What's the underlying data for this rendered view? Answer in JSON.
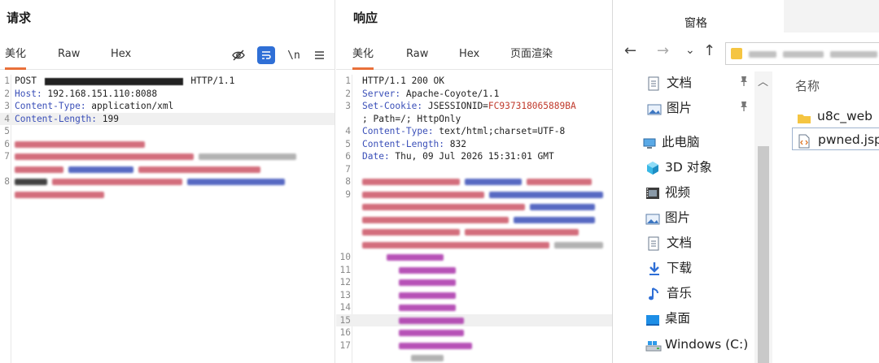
{
  "request": {
    "title": "请求",
    "tabs": [
      "美化",
      "Raw",
      "Hex"
    ],
    "tools": [
      "\\n"
    ],
    "lines": [
      {
        "n": "1",
        "parts": [
          {
            "t": "POST "
          },
          {
            "redact": true
          },
          {
            "t": " HTTP/1.1"
          }
        ]
      },
      {
        "n": "2",
        "parts": [
          {
            "t": "Host: ",
            "c": "k"
          },
          {
            "t": "192.168.151.110:8088"
          }
        ]
      },
      {
        "n": "3",
        "parts": [
          {
            "t": "Content-Type: ",
            "c": "k"
          },
          {
            "t": "application/xml"
          }
        ]
      },
      {
        "n": "4",
        "hl": true,
        "parts": [
          {
            "t": "Content-Length: ",
            "c": "k"
          },
          {
            "t": "199"
          }
        ]
      },
      {
        "n": "5",
        "parts": []
      },
      {
        "n": "6",
        "blur": [
          [
            "#c56",
            160
          ]
        ]
      },
      {
        "n": "7",
        "blur": [
          [
            "#c56",
            220
          ],
          [
            "#a5a5a5",
            120
          ]
        ]
      },
      {
        "n": "",
        "blur": [
          [
            "#c56",
            60
          ],
          [
            "#3a4fb8",
            80
          ],
          [
            "#c56",
            150
          ]
        ]
      },
      {
        "n": "8",
        "blur": [
          [
            "#222",
            40
          ],
          [
            "#c56",
            160
          ],
          [
            "#3a4fb8",
            120
          ]
        ]
      },
      {
        "n": "",
        "blur": [
          [
            "#c56",
            110
          ]
        ]
      }
    ]
  },
  "response": {
    "title": "响应",
    "tabs": [
      "美化",
      "Raw",
      "Hex",
      "页面渲染"
    ],
    "lines": [
      {
        "n": "1",
        "parts": [
          {
            "t": "HTTP/1.1 200 OK"
          }
        ]
      },
      {
        "n": "2",
        "parts": [
          {
            "t": "Server: ",
            "c": "k"
          },
          {
            "t": "Apache-Coyote/1.1"
          }
        ]
      },
      {
        "n": "3",
        "parts": [
          {
            "t": "Set-Cookie: ",
            "c": "k"
          },
          {
            "t": "JSESSIONID="
          },
          {
            "t": "FC937318065889BA",
            "c": "red"
          }
        ]
      },
      {
        "n": "",
        "parts": [
          {
            "t": "; Path=/; HttpOnly"
          }
        ]
      },
      {
        "n": "4",
        "parts": [
          {
            "t": "Content-Type: ",
            "c": "k"
          },
          {
            "t": "text/html;charset=UTF-8"
          }
        ]
      },
      {
        "n": "5",
        "parts": [
          {
            "t": "Content-Length: ",
            "c": "k"
          },
          {
            "t": "832"
          }
        ]
      },
      {
        "n": "6",
        "parts": [
          {
            "t": "Date: ",
            "c": "k"
          },
          {
            "t": "Thu, 09 Jul 2026 15:31:01 GMT"
          }
        ]
      },
      {
        "n": "7",
        "parts": []
      },
      {
        "n": "8",
        "blur": [
          [
            "#c56",
            120
          ],
          [
            "#3a4fb8",
            70
          ],
          [
            "#c56",
            80
          ]
        ]
      },
      {
        "n": "9",
        "blur": [
          [
            "#c56",
            150
          ],
          [
            "#3a4fb8",
            140
          ]
        ]
      },
      {
        "n": "",
        "blur": [
          [
            "#c56",
            200
          ],
          [
            "#3a4fb8",
            80
          ]
        ]
      },
      {
        "n": "",
        "blur": [
          [
            "#c56",
            180
          ],
          [
            "#3a4fb8",
            100
          ]
        ]
      },
      {
        "n": "",
        "blur": [
          [
            "#c56",
            120
          ],
          [
            "#c56",
            140
          ]
        ]
      },
      {
        "n": "",
        "blur": [
          [
            "#c56",
            230
          ],
          [
            "#a5a5a5",
            60
          ]
        ]
      },
      {
        "n": "10",
        "blur": [
          [
            "#a3a",
            70
          ]
        ],
        "indent": 30
      },
      {
        "n": "11",
        "blur": [
          [
            "#a3a",
            70
          ]
        ],
        "indent": 45
      },
      {
        "n": "12",
        "blur": [
          [
            "#a3a",
            70
          ]
        ],
        "indent": 45
      },
      {
        "n": "13",
        "blur": [
          [
            "#a3a",
            70
          ]
        ],
        "indent": 45
      },
      {
        "n": "14",
        "blur": [
          [
            "#a3a",
            70
          ]
        ],
        "indent": 45
      },
      {
        "n": "15",
        "hl": true,
        "blur": [
          [
            "#a3a",
            80
          ]
        ],
        "indent": 45
      },
      {
        "n": "16",
        "blur": [
          [
            "#a3a",
            80
          ]
        ],
        "indent": 45
      },
      {
        "n": "17",
        "blur": [
          [
            "#a3a",
            90
          ]
        ],
        "indent": 45
      },
      {
        "n": "",
        "blur": [
          [
            "#a5a5a5",
            40
          ]
        ],
        "indent": 60
      }
    ]
  },
  "explorer": {
    "title": "窗格",
    "nav": {
      "back": "←",
      "forward": "→",
      "recent": "⌄",
      "up": "↑"
    },
    "tree": [
      {
        "label": "文档",
        "icon": "document-icon",
        "pinned": true
      },
      {
        "label": "图片",
        "icon": "pictures-icon",
        "pinned": true
      },
      {
        "label": "此电脑",
        "icon": "computer-icon"
      },
      {
        "label": "3D 对象",
        "icon": "3d-objects-icon"
      },
      {
        "label": "视频",
        "icon": "video-icon"
      },
      {
        "label": "图片",
        "icon": "pictures-icon"
      },
      {
        "label": "文档",
        "icon": "document-icon"
      },
      {
        "label": "下载",
        "icon": "download-icon"
      },
      {
        "label": "音乐",
        "icon": "music-icon"
      },
      {
        "label": "桌面",
        "icon": "desktop-icon"
      },
      {
        "label": "Windows (C:)",
        "icon": "drive-icon"
      }
    ],
    "column_name": "名称",
    "files": [
      {
        "name": "u8c_web",
        "icon": "folder-icon"
      },
      {
        "name": "pwned.jsp",
        "icon": "jsp-file-icon",
        "selected": true
      }
    ],
    "colors": {
      "folder": "#f5c542",
      "accent": "#2f6fd6",
      "tab_underline": "#e9703a"
    }
  }
}
